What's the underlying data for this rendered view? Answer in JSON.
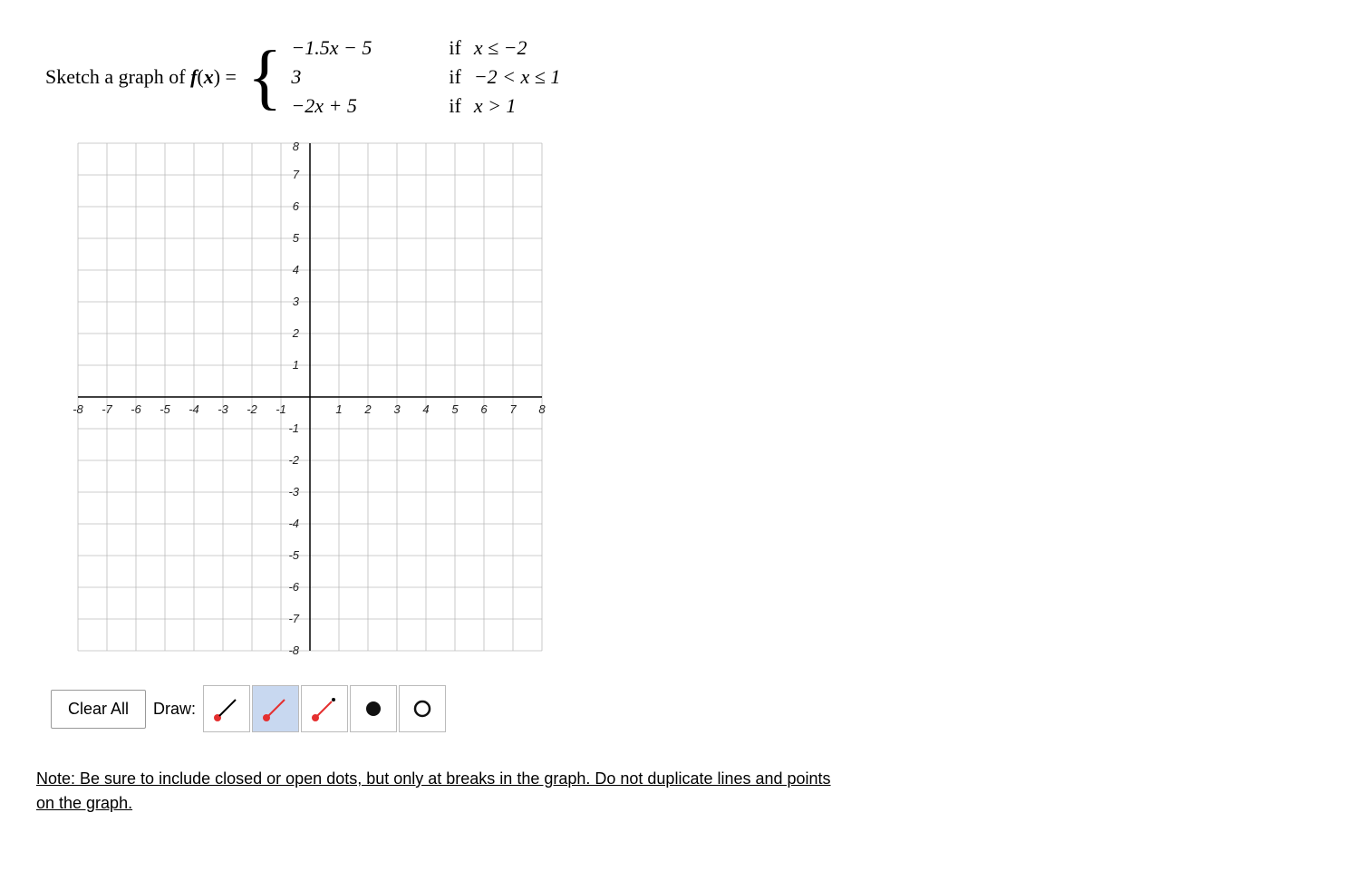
{
  "problem": {
    "sketch_label": "Sketch a graph of",
    "function_name": "f(x)",
    "equals": "=",
    "cases": [
      {
        "expr": "−1.5x − 5",
        "condition_keyword": "if",
        "condition": "x ≤ −2"
      },
      {
        "expr": "3",
        "condition_keyword": "if",
        "condition": "−2 < x ≤ 1"
      },
      {
        "expr": "−2x + 5",
        "condition_keyword": "if",
        "condition": "x > 1"
      }
    ]
  },
  "graph": {
    "x_min": -8,
    "x_max": 8,
    "y_min": -8,
    "y_max": 8
  },
  "toolbar": {
    "clear_all_label": "Clear All",
    "draw_label": "Draw:",
    "tools": [
      {
        "id": "line",
        "label": "line tool",
        "active": false
      },
      {
        "id": "ray",
        "label": "ray tool",
        "active": true
      },
      {
        "id": "segment",
        "label": "segment tool",
        "active": false
      },
      {
        "id": "closed-dot",
        "label": "closed dot tool",
        "active": false
      },
      {
        "id": "open-dot",
        "label": "open dot tool",
        "active": false
      }
    ]
  },
  "note": {
    "text": "Note: Be sure to include closed or open dots, but only at breaks in the graph. Do not duplicate lines and points on the graph."
  }
}
